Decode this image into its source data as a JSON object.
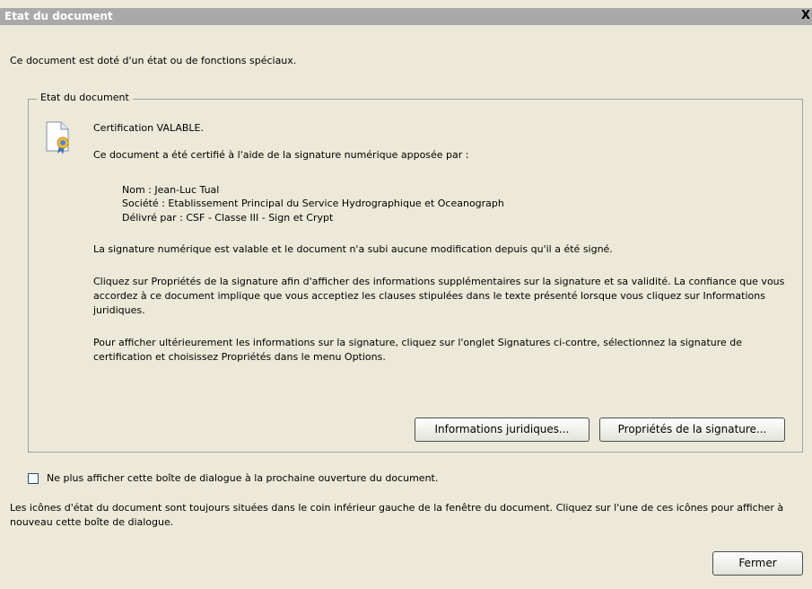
{
  "window": {
    "title": "Etat du document",
    "close_glyph": "X"
  },
  "intro": "Ce document est doté d'un état ou de fonctions spéciaux.",
  "group": {
    "legend": "Etat du document",
    "icon": "certified-document-icon",
    "cert_status": "Certification VALABLE.",
    "certified_by": "Ce document a été certifié à l'aide de la signature numérique apposée par :",
    "signer_name": "Nom : Jean-Luc Tual",
    "signer_company": "Société : Etablissement Principal du Service Hydrographique et Oceanograph",
    "signer_issuer": "Délivré par : CSF - Classe III - Sign et Crypt",
    "valid_text": "La signature numérique est valable et le document n'a subi aucune modification depuis qu'il a été signé.",
    "properties_help": "Cliquez sur Propriétés de la signature afin d'afficher des informations supplémentaires sur la signature et sa validité. La confiance que vous accordez à ce document implique que vous acceptiez les clauses stipulées dans le texte présenté lorsque vous cliquez sur Informations juridiques.",
    "later_help": "Pour afficher ultérieurement les informations sur la signature, cliquez sur l'onglet Signatures ci-contre, sélectionnez la signature de certification et choisissez Propriétés dans le menu Options.",
    "legal_button": "Informations juridiques...",
    "properties_button": "Propriétés de la signature..."
  },
  "checkbox": {
    "label": "Ne plus afficher cette boîte de dialogue à la prochaine ouverture du document.",
    "checked": false
  },
  "footer_text": "Les icônes d'état du document sont toujours situées dans le coin inférieur gauche de la fenêtre du document. Cliquez sur l'une de ces icônes pour afficher à nouveau cette boîte de dialogue.",
  "close_button": "Fermer"
}
